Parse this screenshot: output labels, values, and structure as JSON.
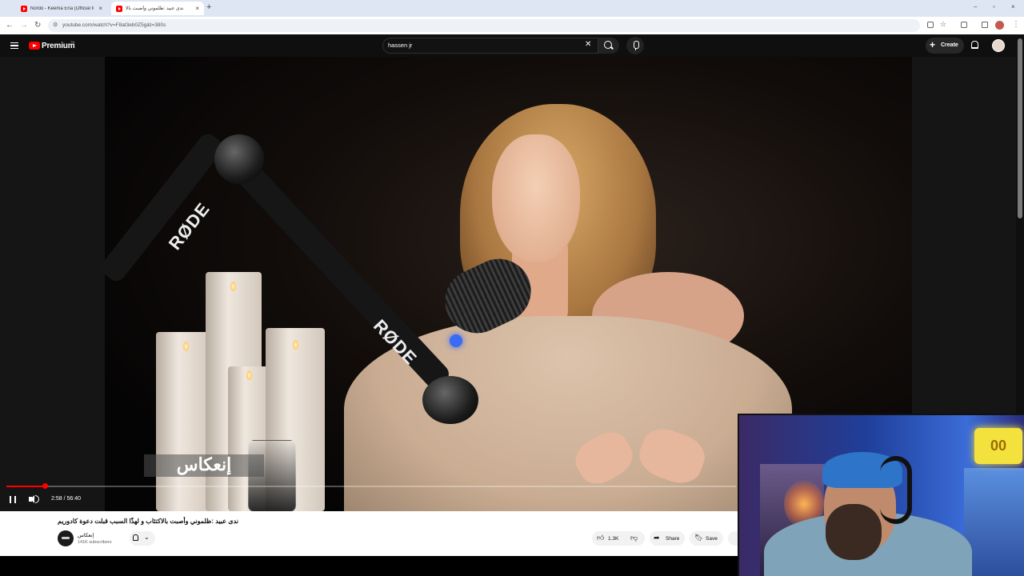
{
  "browser": {
    "tabs": [
      {
        "title": "Nordo - Keema Ena (Official M",
        "active": false
      },
      {
        "title": "ندى عبيد :ظلموني وأصبت بالا",
        "active": true
      }
    ],
    "new_tab_icon": "plus-icon",
    "url": "youtube.com/watch?v=F8at3eb0Z5g&t=380s"
  },
  "youtube": {
    "brand": "Premium",
    "country_code": "TN",
    "search": {
      "value": "hassen jr"
    },
    "create_label": "Create"
  },
  "player": {
    "watermark": "إنعكاس",
    "timecode": "2:58 / 56:40",
    "progress_fraction": 0.0523,
    "overlay_text_rode": "RØDE"
  },
  "video": {
    "title": "ندى عبيد :ظلموني وأصبت بالاكتئاب و لهذّا السبب قبلت دعوة كادوريم",
    "channel_name": "إنعكاس",
    "subscribers": "141K subscribers",
    "likes": "1.3K",
    "share_label": "Share",
    "save_label": "Save"
  },
  "webcam": {
    "neon_sign": "00"
  }
}
